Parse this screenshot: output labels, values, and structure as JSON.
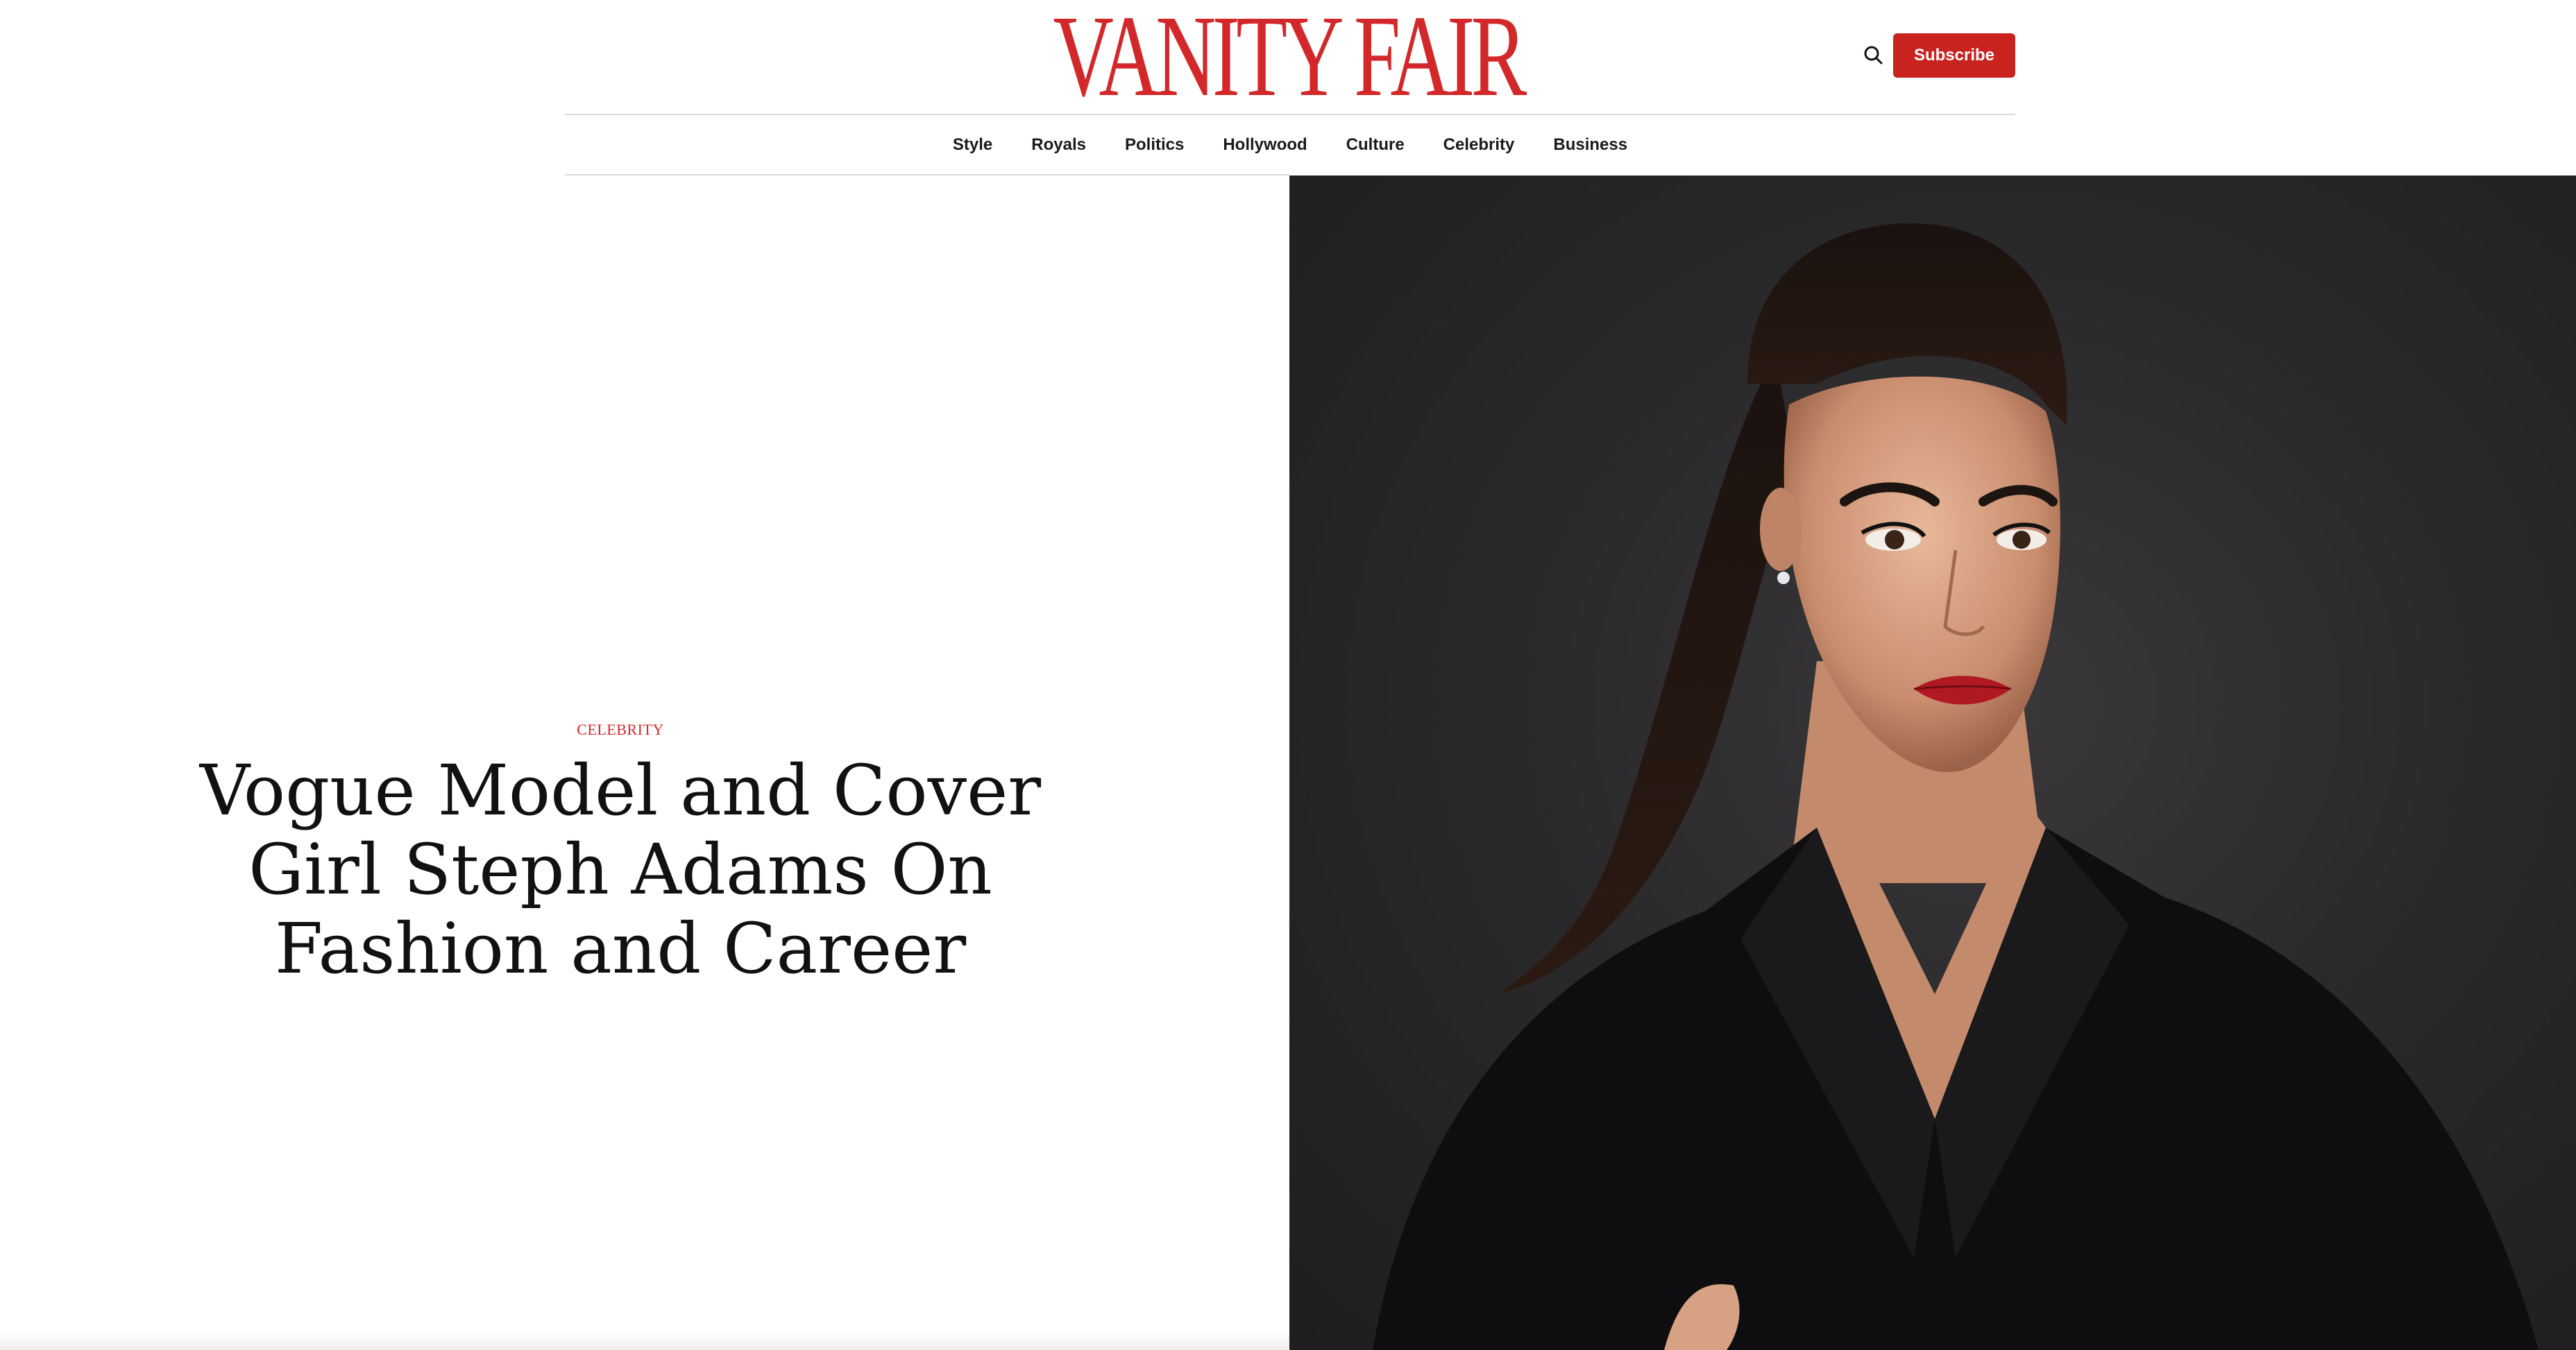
{
  "header": {
    "logo_text": "VANITY FAIR",
    "search_icon": "search-icon",
    "subscribe_label": "Subscribe"
  },
  "nav": {
    "items": [
      {
        "label": "Style"
      },
      {
        "label": "Royals"
      },
      {
        "label": "Politics"
      },
      {
        "label": "Hollywood"
      },
      {
        "label": "Culture"
      },
      {
        "label": "Celebrity"
      },
      {
        "label": "Business"
      }
    ]
  },
  "article": {
    "category": "CELEBRITY",
    "headline": "Vogue Model and Cover Girl Steph Adams On Fashion and Career"
  },
  "colors": {
    "brand_red": "#d3282a",
    "subscribe_red": "#c9231f",
    "photo_background": "#2a292b"
  }
}
